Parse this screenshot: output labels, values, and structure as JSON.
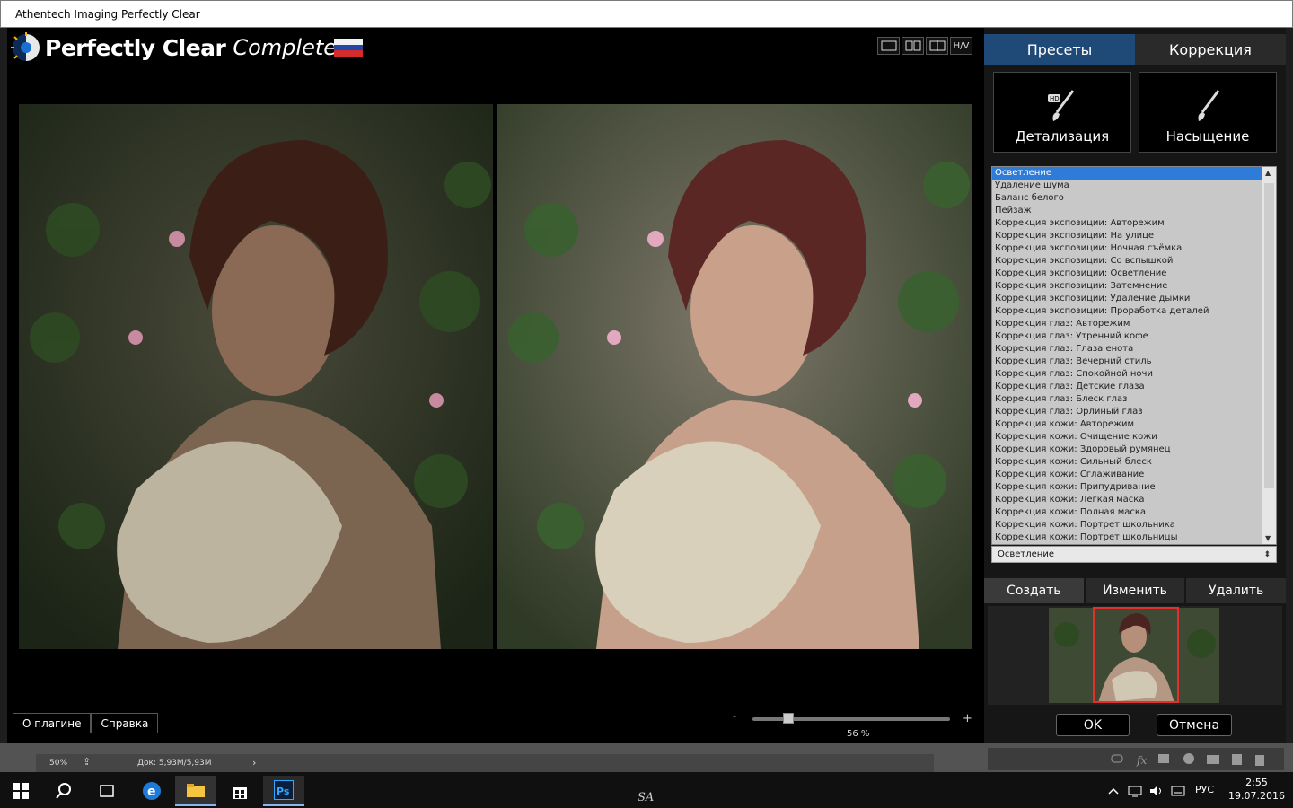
{
  "window": {
    "title": "Athentech Imaging Perfectly Clear"
  },
  "logo": {
    "brand": "Perfectly Clear",
    "edition": "Complete"
  },
  "view_modes": [
    "single-view-icon",
    "side-by-side-icon",
    "split-view-icon"
  ],
  "view_hv_label": "H/V",
  "panel": {
    "tabs": [
      "Пресеты",
      "Коррекция"
    ],
    "big_buttons": [
      "Детализация",
      "Насыщение"
    ],
    "presets": [
      "Осветление",
      "Удаление шума",
      "Баланс белого",
      "Пейзаж",
      "Коррекция экспозиции: Авторежим",
      "Коррекция экспозиции: На улице",
      "Коррекция экспозиции: Ночная съёмка",
      "Коррекция экспозиции: Со вспышкой",
      "Коррекция экспозиции: Осветление",
      "Коррекция экспозиции: Затемнение",
      "Коррекция экспозиции: Удаление дымки",
      "Коррекция экспозиции: Проработка деталей",
      "Коррекция глаз: Авторежим",
      "Коррекция глаз: Утренний кофе",
      "Коррекция глаз: Глаза енота",
      "Коррекция глаз: Вечерний стиль",
      "Коррекция глаз: Спокойной ночи",
      "Коррекция глаз: Детские глаза",
      "Коррекция глаз: Блеск глаз",
      "Коррекция глаз: Орлиный глаз",
      "Коррекция кожи: Авторежим",
      "Коррекция кожи: Очищение кожи",
      "Коррекция кожи: Здоровый румянец",
      "Коррекция кожи: Сильный блеск",
      "Коррекция кожи: Сглаживание",
      "Коррекция кожи: Припудривание",
      "Коррекция кожи: Легкая маска",
      "Коррекция кожи: Полная маска",
      "Коррекция кожи: Портрет школьника",
      "Коррекция кожи: Портрет школьницы"
    ],
    "selected_preset": "Осветление",
    "actions": [
      "Создать",
      "Изменить",
      "Удалить"
    ],
    "ok": "OK",
    "cancel": "Отмена"
  },
  "footer": {
    "about": "О плагине",
    "help": "Справка",
    "zoom_minus": "-",
    "zoom_plus": "+",
    "zoom_label": "56 %",
    "zoom_fraction": 0.18
  },
  "photoshop_status": {
    "zoom": "50%",
    "doc": "Док: 5,93M/5,93M"
  },
  "taskbar": {
    "lang": "РУС",
    "time": "2:55",
    "date": "19.07.2016",
    "watermark": "SA"
  }
}
